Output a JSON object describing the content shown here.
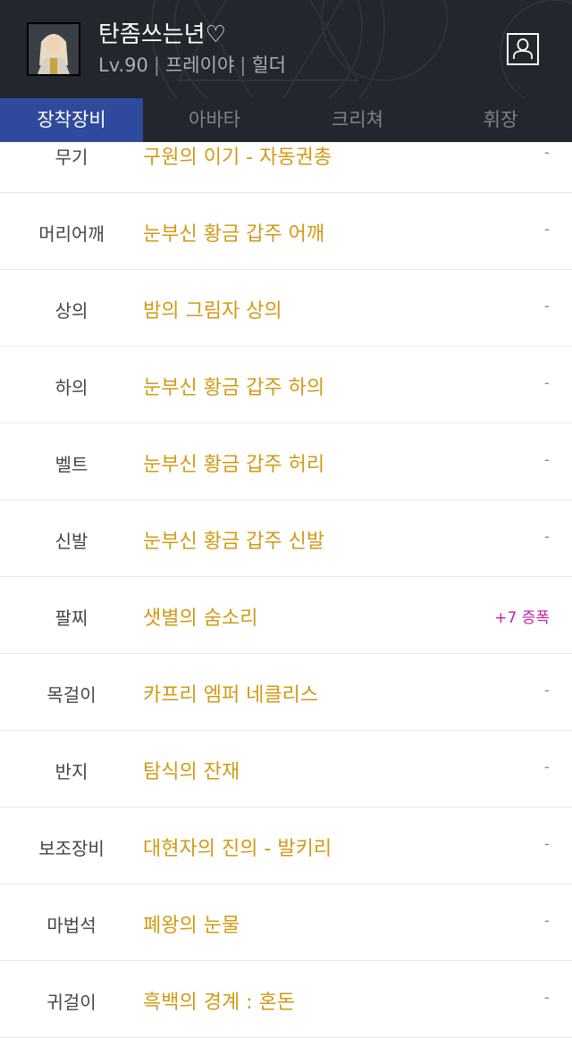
{
  "character": {
    "name": "탄좀쓰는년♡",
    "level": "Lv.90",
    "server": "프레이야",
    "class": "힐더"
  },
  "tabs": [
    {
      "label": "장착장비",
      "active": true
    },
    {
      "label": "아바타",
      "active": false
    },
    {
      "label": "크리쳐",
      "active": false
    },
    {
      "label": "휘장",
      "active": false
    }
  ],
  "equipment": [
    {
      "slot": "무기",
      "item": "구원의 이기 - 자동권총",
      "extra": "-"
    },
    {
      "slot": "머리어깨",
      "item": "눈부신 황금 갑주 어깨",
      "extra": "-"
    },
    {
      "slot": "상의",
      "item": "밤의 그림자 상의",
      "extra": "-"
    },
    {
      "slot": "하의",
      "item": "눈부신 황금 갑주 하의",
      "extra": "-"
    },
    {
      "slot": "벨트",
      "item": "눈부신 황금 갑주 허리",
      "extra": "-"
    },
    {
      "slot": "신발",
      "item": "눈부신 황금 갑주 신발",
      "extra": "-"
    },
    {
      "slot": "팔찌",
      "item": "샛별의 숨소리",
      "extra": "+7 증폭"
    },
    {
      "slot": "목걸이",
      "item": "카프리 엠퍼 네클리스",
      "extra": "-"
    },
    {
      "slot": "반지",
      "item": "탐식의 잔재",
      "extra": "-"
    },
    {
      "slot": "보조장비",
      "item": "대현자의 진의 - 발키리",
      "extra": "-"
    },
    {
      "slot": "마법석",
      "item": "폐왕의 눈물",
      "extra": "-"
    },
    {
      "slot": "귀걸이",
      "item": "흑백의 경계 : 혼돈",
      "extra": "-"
    }
  ],
  "colors": {
    "header_bg": "#23262d",
    "active_tab": "#2f4a9c",
    "item_name": "#d29a14",
    "amplified": "#cc1ea8"
  },
  "icons": {
    "profile": "person-icon",
    "avatar": "character-portrait"
  }
}
